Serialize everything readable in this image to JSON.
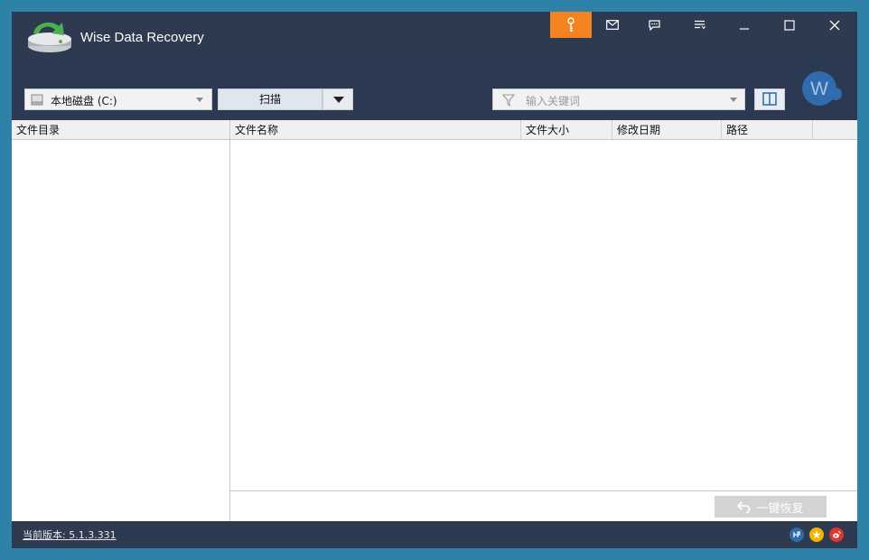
{
  "app": {
    "title": "Wise Data Recovery"
  },
  "toolbar": {
    "drive_select": {
      "value": "本地磁盘 (C:)"
    },
    "scan_label": "扫描",
    "filter": {
      "placeholder": "输入关键词"
    },
    "avatar_letter": "W"
  },
  "folder_pane": {
    "header": "文件目录"
  },
  "file_list": {
    "columns": [
      "文件名称",
      "文件大小",
      "修改日期",
      "路径"
    ]
  },
  "actions": {
    "recover_label": "一键恢复"
  },
  "status": {
    "version": "当前版本: 5.1.3.331"
  },
  "colors": {
    "accent": "#f58220",
    "titlebar": "#2e3a4f",
    "toolbar": "#2b3952"
  },
  "icons": [
    "key-icon",
    "mail-icon",
    "feedback-icon",
    "menu-icon",
    "minimize-icon",
    "maximize-icon",
    "close-icon",
    "disk-icon",
    "filter-icon",
    "layout-icon",
    "undo-icon",
    "social-icons"
  ]
}
